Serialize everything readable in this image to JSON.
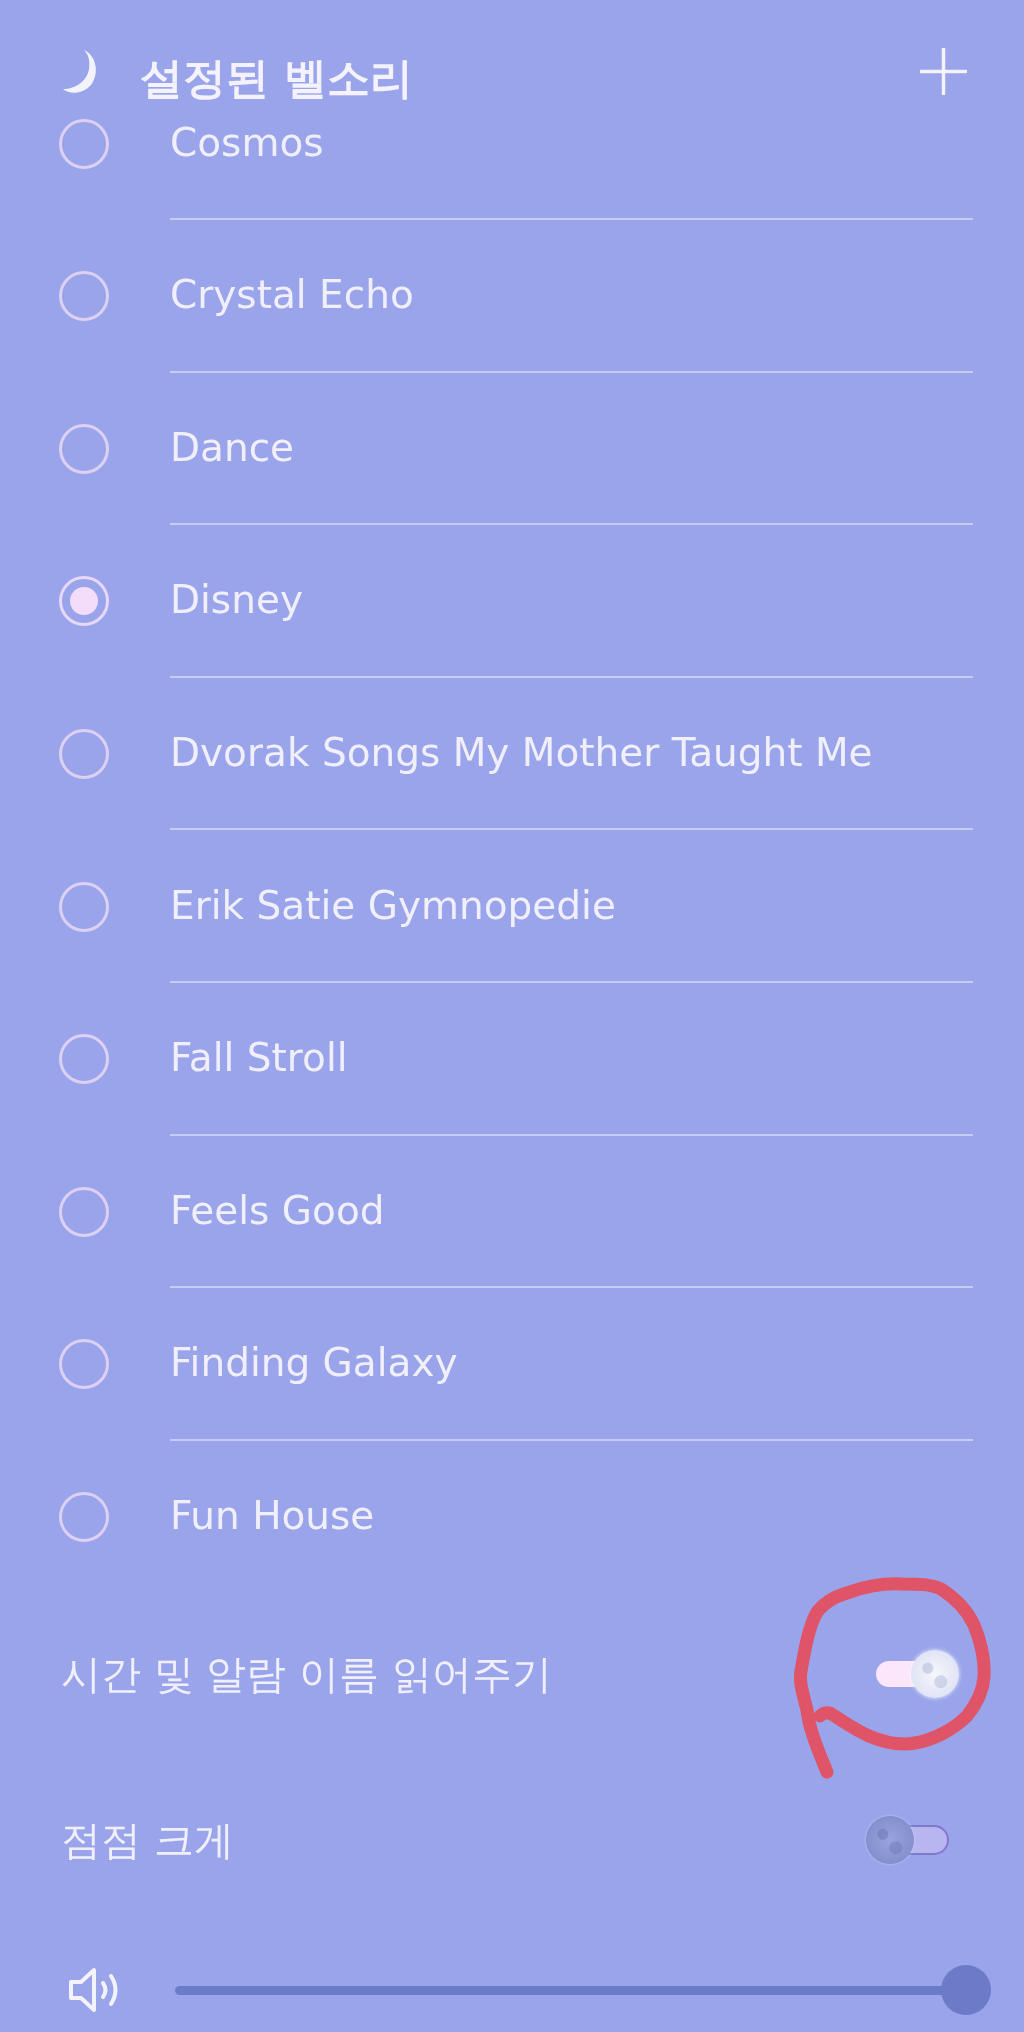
{
  "header": {
    "title": "설정된 벨소리"
  },
  "ringtones": [
    {
      "name": "Cosmos",
      "selected": false
    },
    {
      "name": "Crystal Echo",
      "selected": false
    },
    {
      "name": "Dance",
      "selected": false
    },
    {
      "name": "Disney",
      "selected": true
    },
    {
      "name": "Dvorak Songs My Mother Taught Me",
      "selected": false
    },
    {
      "name": "Erik Satie Gymnopedie",
      "selected": false
    },
    {
      "name": "Fall Stroll",
      "selected": false
    },
    {
      "name": "Feels Good",
      "selected": false
    },
    {
      "name": "Finding Galaxy",
      "selected": false
    },
    {
      "name": "Fun House",
      "selected": false
    }
  ],
  "settings": [
    {
      "label": "시간 및 알람 이름 읽어주기",
      "on": true,
      "circled": true
    },
    {
      "label": "점점 크게",
      "on": false,
      "circled": false
    }
  ],
  "volume": {
    "level": 1
  }
}
